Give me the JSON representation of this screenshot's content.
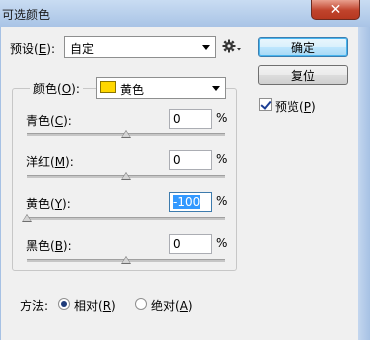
{
  "window": {
    "title": "可选颜色",
    "close_glyph": "✕"
  },
  "preset": {
    "label": "预设(",
    "key": "E",
    "label_end": "):",
    "value": "自定"
  },
  "buttons": {
    "ok": "确定",
    "reset": "复位"
  },
  "preview": {
    "label": "预览(",
    "key": "P",
    "label_end": ")",
    "checked": true
  },
  "colors": {
    "label": "颜色(",
    "key": "O",
    "label_end": "):",
    "value": "黄色",
    "swatch": "#ffd700"
  },
  "sliders": [
    {
      "label": "青色(",
      "key": "C",
      "label_end": "):",
      "value": "0",
      "unit": "%",
      "level": 0
    },
    {
      "label": "洋红(",
      "key": "M",
      "label_end": "):",
      "value": "0",
      "unit": "%",
      "level": 0
    },
    {
      "label": "黄色(",
      "key": "Y",
      "label_end": "):",
      "value": "-100",
      "unit": "%",
      "level": -100
    },
    {
      "label": "黑色(",
      "key": "B",
      "label_end": "):",
      "value": "0",
      "unit": "%",
      "level": 0
    }
  ],
  "method": {
    "label": "方法:",
    "options": [
      {
        "label": "相对(",
        "key": "R",
        "label_end": ")",
        "selected": true
      },
      {
        "label": "绝对(",
        "key": "A",
        "label_end": ")",
        "selected": false
      }
    ]
  }
}
